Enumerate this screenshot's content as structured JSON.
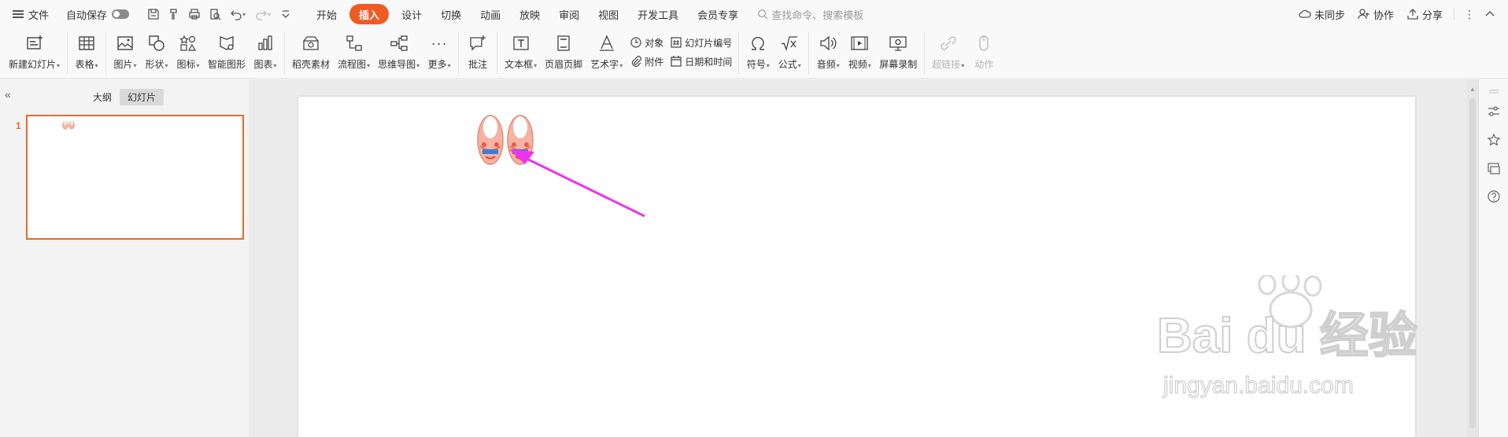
{
  "menubar": {
    "file": "文件",
    "autosave": "自动保存",
    "tabs": [
      "开始",
      "插入",
      "设计",
      "切换",
      "动画",
      "放映",
      "审阅",
      "视图",
      "开发工具",
      "会员专享"
    ],
    "search_placeholder": "查找命令、搜索模板",
    "sync": "未同步",
    "collab": "协作",
    "share": "分享"
  },
  "ribbon": {
    "new_slide": "新建幻灯片",
    "table": "表格",
    "picture": "图片",
    "shape": "形状",
    "icon": "图标",
    "smart_graphic": "智能图形",
    "chart": "图表",
    "shell_material": "稻壳素材",
    "flowchart": "流程图",
    "mindmap": "思维导图",
    "more": "更多",
    "comment": "批注",
    "textbox": "文本框",
    "header_footer": "页眉页脚",
    "wordart": "艺术字",
    "object": "对象",
    "attachment": "附件",
    "slide_number": "幻灯片编号",
    "date_time": "日期和时间",
    "symbol": "符号",
    "formula": "公式",
    "audio": "音频",
    "video": "视频",
    "screen_record": "屏幕录制",
    "hyperlink": "超链接",
    "action": "动作"
  },
  "leftpanel": {
    "tab_outline": "大纲",
    "tab_slides": "幻灯片",
    "slide_number": "1"
  },
  "colors": {
    "accent": "#f05a24",
    "slide_border": "#e26b2c",
    "arrow": "#ee33ee",
    "bib": "#f6b3a4"
  },
  "watermark": {
    "brand": "Bai du 经验",
    "url": "jingyan.baidu.com"
  }
}
